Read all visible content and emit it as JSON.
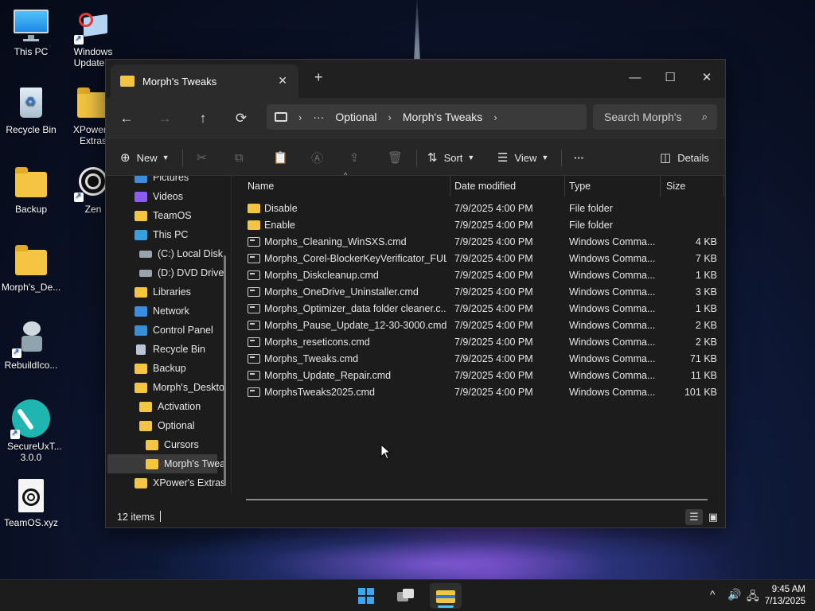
{
  "desktop": {
    "icons": [
      {
        "label": "This PC",
        "icon": "monitor-icon"
      },
      {
        "label": "Windows Update...",
        "icon": "windows-update-icon"
      },
      {
        "label": "Recycle Bin",
        "icon": "recycle-bin-icon"
      },
      {
        "label": "XPower's Extras",
        "icon": "folder-icon"
      },
      {
        "label": "Backup",
        "icon": "folder-icon"
      },
      {
        "label": "Zen",
        "icon": "zen-icon"
      },
      {
        "label": "Morph's_De...",
        "icon": "folder-icon"
      },
      {
        "label": "RebuildIco...",
        "icon": "robot-icon"
      },
      {
        "label": "SecureUxT... 3.0.0",
        "icon": "brush-icon"
      },
      {
        "label": "TeamOS.xyz",
        "icon": "file-icon"
      }
    ]
  },
  "window": {
    "tab_title": "Morph's Tweaks",
    "new_tab_glyph": "+",
    "close_tab_glyph": "✕",
    "controls": {
      "minimize": "—",
      "maximize": "☐",
      "close": "✕"
    },
    "nav": {
      "back": "←",
      "forward": "→",
      "up": "↑",
      "refresh": "⟳"
    },
    "address": {
      "more": "···",
      "segments": [
        "Optional",
        "Morph's Tweaks"
      ],
      "chevron": "›"
    },
    "search_placeholder": "Search Morph's",
    "toolbar": {
      "new_label": "New",
      "sort_label": "Sort",
      "view_label": "View",
      "more_label": "···",
      "details_label": "Details"
    },
    "sidebar": [
      {
        "label": "Pictures",
        "icon": "pictures",
        "indent": 1
      },
      {
        "label": "Videos",
        "icon": "videos",
        "indent": 1
      },
      {
        "label": "TeamOS",
        "icon": "folder",
        "indent": 1
      },
      {
        "label": "This PC",
        "icon": "pc",
        "indent": 1
      },
      {
        "label": "(C:) Local Disk",
        "icon": "drive",
        "indent": 2
      },
      {
        "label": "(D:) DVD Drive",
        "icon": "drive",
        "indent": 2
      },
      {
        "label": "Libraries",
        "icon": "libraries",
        "indent": 1
      },
      {
        "label": "Network",
        "icon": "network",
        "indent": 1
      },
      {
        "label": "Control Panel",
        "icon": "control",
        "indent": 1
      },
      {
        "label": "Recycle Bin",
        "icon": "recycle",
        "indent": 1
      },
      {
        "label": "Backup",
        "icon": "folder",
        "indent": 1
      },
      {
        "label": "Morph's_Deskto",
        "icon": "folder",
        "indent": 1
      },
      {
        "label": "Activation",
        "icon": "folder",
        "indent": 2
      },
      {
        "label": "Optional",
        "icon": "folder",
        "indent": 2
      },
      {
        "label": "Cursors",
        "icon": "folder",
        "indent": 3
      },
      {
        "label": "Morph's Twea",
        "icon": "folder",
        "indent": 3,
        "selected": true
      },
      {
        "label": "XPower's Extras",
        "icon": "folder",
        "indent": 1
      }
    ],
    "columns": {
      "name": "Name",
      "date": "Date modified",
      "type": "Type",
      "size": "Size"
    },
    "files": [
      {
        "name": "Disable",
        "date": "7/9/2025 4:00 PM",
        "type": "File folder",
        "size": "",
        "kind": "folder"
      },
      {
        "name": "Enable",
        "date": "7/9/2025 4:00 PM",
        "type": "File folder",
        "size": "",
        "kind": "folder"
      },
      {
        "name": "Morphs_Cleaning_WinSXS.cmd",
        "date": "7/9/2025 4:00 PM",
        "type": "Windows Comma...",
        "size": "4 KB",
        "kind": "cmd"
      },
      {
        "name": "Morphs_Corel-BlockerKeyVerificator_FUL...",
        "date": "7/9/2025 4:00 PM",
        "type": "Windows Comma...",
        "size": "7 KB",
        "kind": "cmd"
      },
      {
        "name": "Morphs_Diskcleanup.cmd",
        "date": "7/9/2025 4:00 PM",
        "type": "Windows Comma...",
        "size": "1 KB",
        "kind": "cmd"
      },
      {
        "name": "Morphs_OneDrive_Uninstaller.cmd",
        "date": "7/9/2025 4:00 PM",
        "type": "Windows Comma...",
        "size": "3 KB",
        "kind": "cmd"
      },
      {
        "name": "Morphs_Optimizer_data folder cleaner.c...",
        "date": "7/9/2025 4:00 PM",
        "type": "Windows Comma...",
        "size": "1 KB",
        "kind": "cmd"
      },
      {
        "name": "Morphs_Pause_Update_12-30-3000.cmd",
        "date": "7/9/2025 4:00 PM",
        "type": "Windows Comma...",
        "size": "2 KB",
        "kind": "cmd"
      },
      {
        "name": "Morphs_reseticons.cmd",
        "date": "7/9/2025 4:00 PM",
        "type": "Windows Comma...",
        "size": "2 KB",
        "kind": "cmd"
      },
      {
        "name": "Morphs_Tweaks.cmd",
        "date": "7/9/2025 4:00 PM",
        "type": "Windows Comma...",
        "size": "71 KB",
        "kind": "cmd"
      },
      {
        "name": "Morphs_Update_Repair.cmd",
        "date": "7/9/2025 4:00 PM",
        "type": "Windows Comma...",
        "size": "11 KB",
        "kind": "cmd"
      },
      {
        "name": "MorphsTweaks2025.cmd",
        "date": "7/9/2025 4:00 PM",
        "type": "Windows Comma...",
        "size": "101 KB",
        "kind": "cmd"
      }
    ],
    "status": {
      "item_count": "12 items"
    }
  },
  "taskbar": {
    "time": "9:45 AM",
    "date": "7/13/2025",
    "tray": {
      "chevron": "^",
      "volume": "🔊",
      "network": "🖧"
    }
  },
  "colors": {
    "accent": "#4cc2ff",
    "folder": "#f4c542",
    "window_bg": "#1c1c1c"
  }
}
